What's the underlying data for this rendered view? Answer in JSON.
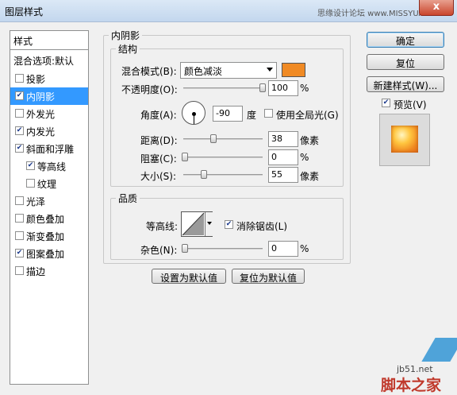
{
  "window": {
    "title": "图层样式",
    "watermark": "思缘设计论坛 www.MISSYUAN.COM",
    "close_label": "x"
  },
  "sidebar": {
    "header": "样式",
    "blend_default": "混合选项:默认",
    "items": [
      {
        "label": "投影",
        "checked": false
      },
      {
        "label": "内阴影",
        "checked": true,
        "selected": true
      },
      {
        "label": "外发光",
        "checked": false
      },
      {
        "label": "内发光",
        "checked": true
      },
      {
        "label": "斜面和浮雕",
        "checked": true
      },
      {
        "label": "等高线",
        "checked": true,
        "sub": true
      },
      {
        "label": "纹理",
        "checked": false,
        "sub": true
      },
      {
        "label": "光泽",
        "checked": false
      },
      {
        "label": "颜色叠加",
        "checked": false
      },
      {
        "label": "渐变叠加",
        "checked": false
      },
      {
        "label": "图案叠加",
        "checked": true
      },
      {
        "label": "描边",
        "checked": false
      }
    ]
  },
  "panel": {
    "title": "内阴影"
  },
  "structure": {
    "title": "结构",
    "blend_mode_label": "混合模式(B):",
    "blend_mode": "颜色减淡",
    "swatch_color": "#f08a24",
    "opacity_label": "不透明度(O):",
    "opacity": "100",
    "opacity_value": 100,
    "angle_label": "角度(A):",
    "angle": "-90",
    "angle_unit": "度",
    "global_light_label": "使用全局光(G)",
    "global_light": false,
    "distance_label": "距离(D):",
    "distance": "38",
    "choke_label": "阻塞(C):",
    "choke": "0",
    "size_label": "大小(S):",
    "size": "55",
    "px_unit": "像素",
    "pct_unit": "%"
  },
  "quality": {
    "title": "品质",
    "contour_label": "等高线:",
    "antialias_label": "消除锯齿(L)",
    "antialias": true,
    "noise_label": "杂色(N):",
    "noise": "0",
    "pct_unit": "%"
  },
  "buttons": {
    "make_default": "设置为默认值",
    "reset_default": "复位为默认值",
    "ok": "确定",
    "reset": "复位",
    "new_style": "新建样式(W)...",
    "preview_label": "预览(V)",
    "preview_checked": true
  },
  "logos": {
    "site": "jb51.net",
    "brand": "脚本之家"
  }
}
